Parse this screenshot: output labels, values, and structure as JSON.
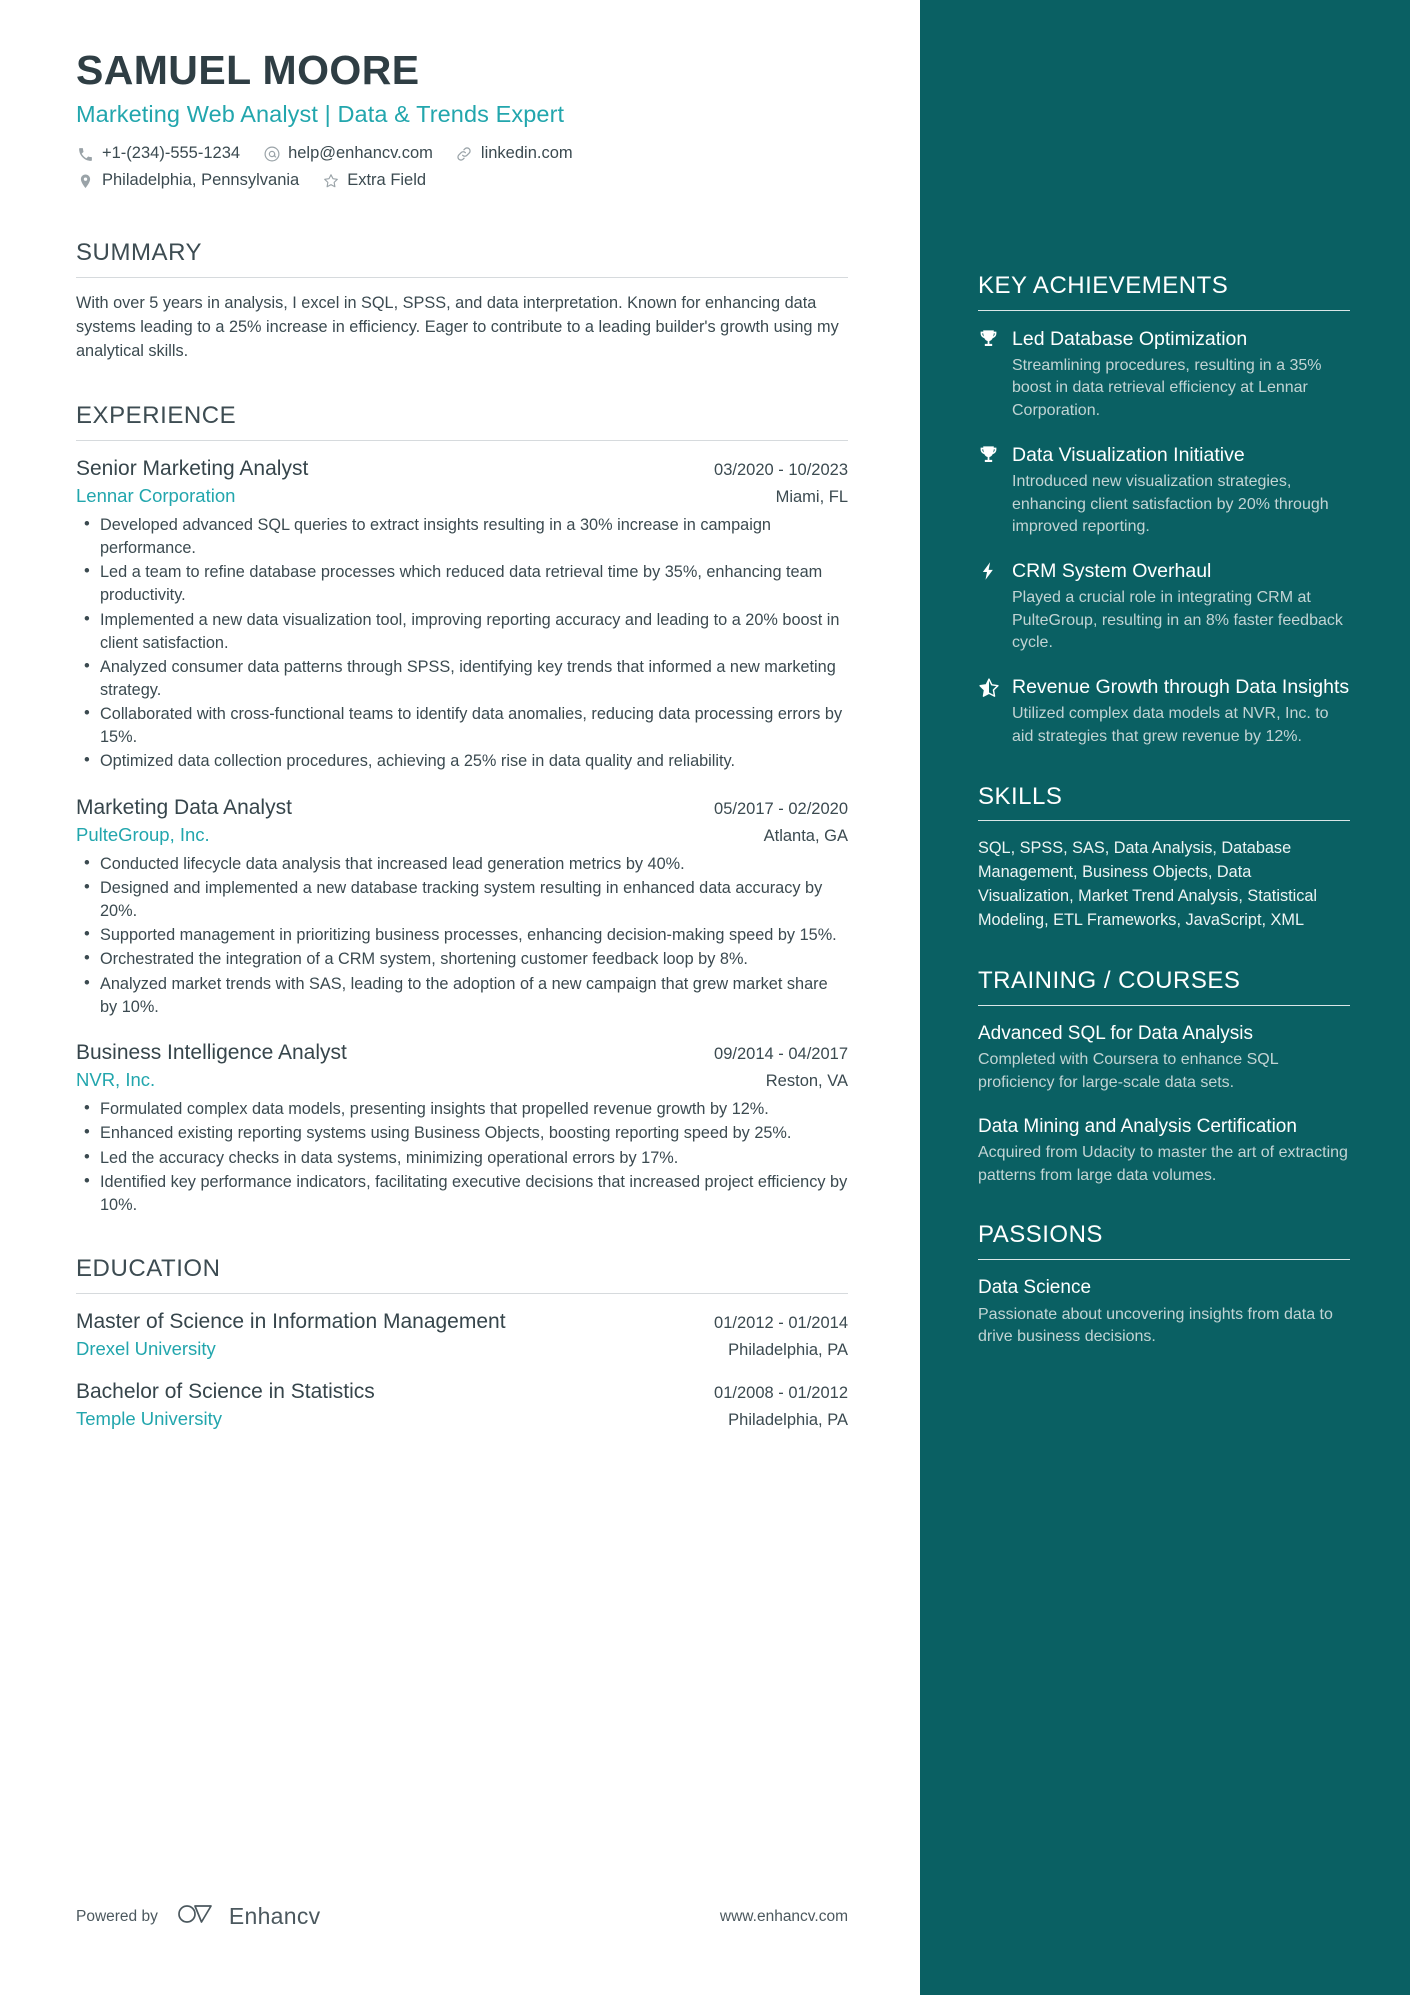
{
  "header": {
    "name": "SAMUEL MOORE",
    "headline": "Marketing Web Analyst | Data & Trends Expert",
    "contacts": [
      {
        "icon": "phone-icon",
        "text": "+1-(234)-555-1234"
      },
      {
        "icon": "email-icon",
        "text": "help@enhancv.com"
      },
      {
        "icon": "link-icon",
        "text": "linkedin.com"
      },
      {
        "icon": "location-icon",
        "text": "Philadelphia, Pennsylvania"
      },
      {
        "icon": "star-icon",
        "text": "Extra Field"
      }
    ]
  },
  "summary": {
    "title": "SUMMARY",
    "text": "With over 5 years in analysis, I excel in SQL, SPSS, and data interpretation. Known for enhancing data systems leading to a 25% increase in efficiency. Eager to contribute to a leading builder's growth using my analytical skills."
  },
  "experience": {
    "title": "EXPERIENCE",
    "entries": [
      {
        "role": "Senior Marketing Analyst",
        "dates": "03/2020 - 10/2023",
        "company": "Lennar Corporation",
        "location": "Miami, FL",
        "bullets": [
          "Developed advanced SQL queries to extract insights resulting in a 30% increase in campaign performance.",
          "Led a team to refine database processes which reduced data retrieval time by 35%, enhancing team productivity.",
          "Implemented a new data visualization tool, improving reporting accuracy and leading to a 20% boost in client satisfaction.",
          "Analyzed consumer data patterns through SPSS, identifying key trends that informed a new marketing strategy.",
          "Collaborated with cross-functional teams to identify data anomalies, reducing data processing errors by 15%.",
          "Optimized data collection procedures, achieving a 25% rise in data quality and reliability."
        ]
      },
      {
        "role": "Marketing Data Analyst",
        "dates": "05/2017 - 02/2020",
        "company": "PulteGroup, Inc.",
        "location": "Atlanta, GA",
        "bullets": [
          "Conducted lifecycle data analysis that increased lead generation metrics by 40%.",
          "Designed and implemented a new database tracking system resulting in enhanced data accuracy by 20%.",
          "Supported management in prioritizing business processes, enhancing decision-making speed by 15%.",
          "Orchestrated the integration of a CRM system, shortening customer feedback loop by 8%.",
          "Analyzed market trends with SAS, leading to the adoption of a new campaign that grew market share by 10%."
        ]
      },
      {
        "role": "Business Intelligence Analyst",
        "dates": "09/2014 - 04/2017",
        "company": "NVR, Inc.",
        "location": "Reston, VA",
        "bullets": [
          "Formulated complex data models, presenting insights that propelled revenue growth by 12%.",
          "Enhanced existing reporting systems using Business Objects, boosting reporting speed by 25%.",
          "Led the accuracy checks in data systems, minimizing operational errors by 17%.",
          "Identified key performance indicators, facilitating executive decisions that increased project efficiency by 10%."
        ]
      }
    ]
  },
  "education": {
    "title": "EDUCATION",
    "entries": [
      {
        "degree": "Master of Science in Information Management",
        "dates": "01/2012 - 01/2014",
        "school": "Drexel University",
        "location": "Philadelphia, PA"
      },
      {
        "degree": "Bachelor of Science in Statistics",
        "dates": "01/2008 - 01/2012",
        "school": "Temple University",
        "location": "Philadelphia, PA"
      }
    ]
  },
  "sidebar": {
    "achievements": {
      "title": "KEY ACHIEVEMENTS",
      "items": [
        {
          "icon": "trophy-icon",
          "title": "Led Database Optimization",
          "desc": "Streamlining procedures, resulting in a 35% boost in data retrieval efficiency at Lennar Corporation."
        },
        {
          "icon": "trophy-icon",
          "title": "Data Visualization Initiative",
          "desc": "Introduced new visualization strategies, enhancing client satisfaction by 20% through improved reporting."
        },
        {
          "icon": "bolt-icon",
          "title": "CRM System Overhaul",
          "desc": "Played a crucial role in integrating CRM at PulteGroup, resulting in an 8% faster feedback cycle."
        },
        {
          "icon": "half-star-icon",
          "title": "Revenue Growth through Data Insights",
          "desc": "Utilized complex data models at NVR, Inc. to aid strategies that grew revenue by 12%."
        }
      ]
    },
    "skills": {
      "title": "SKILLS",
      "text": "SQL, SPSS, SAS, Data Analysis, Database Management, Business Objects, Data Visualization, Market Trend Analysis, Statistical Modeling, ETL Frameworks, JavaScript, XML"
    },
    "training": {
      "title": "TRAINING / COURSES",
      "items": [
        {
          "title": "Advanced SQL for Data Analysis",
          "desc": "Completed with Coursera to enhance SQL proficiency for large-scale data sets."
        },
        {
          "title": "Data Mining and Analysis Certification",
          "desc": "Acquired from Udacity to master the art of extracting patterns from large data volumes."
        }
      ]
    },
    "passions": {
      "title": "PASSIONS",
      "items": [
        {
          "title": "Data Science",
          "desc": "Passionate about uncovering insights from data to drive business decisions."
        }
      ]
    }
  },
  "footer": {
    "powered_by": "Powered by",
    "brand": "Enhancv",
    "url": "www.enhancv.com"
  },
  "colors": {
    "sidebar_bg": "#0a6063",
    "accent": "#22a6ad",
    "heading": "#3d4c52",
    "body": "#3b4a50"
  }
}
